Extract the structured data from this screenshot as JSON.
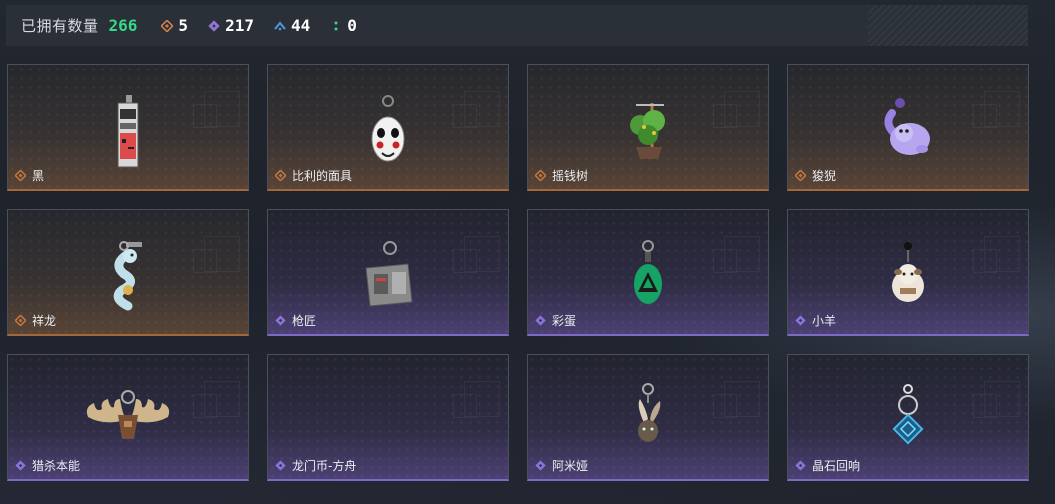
{
  "header": {
    "owned_label": "已拥有数量",
    "owned_count": "266",
    "stats": [
      {
        "icon": "orange-diamond-icon",
        "value": "5",
        "color": "#d0804a"
      },
      {
        "icon": "purple-diamond-icon",
        "value": "217",
        "color": "#8f77d6"
      },
      {
        "icon": "blue-chevron-icon",
        "value": "44",
        "color": "#4f9be0"
      },
      {
        "icon": "green-dots-icon",
        "value": "0",
        "color": "#3fd18f"
      }
    ]
  },
  "colors": {
    "orange": "#c9783d",
    "purple": "#8b72d9",
    "accent_green": "#36d98a"
  },
  "items": [
    {
      "name": "黑",
      "rarity": "orange"
    },
    {
      "name": "比利的面具",
      "rarity": "orange"
    },
    {
      "name": "摇钱树",
      "rarity": "orange"
    },
    {
      "name": "狻猊",
      "rarity": "orange"
    },
    {
      "name": "祥龙",
      "rarity": "orange"
    },
    {
      "name": "枪匠",
      "rarity": "purple"
    },
    {
      "name": "彩蛋",
      "rarity": "purple"
    },
    {
      "name": "小羊",
      "rarity": "purple"
    },
    {
      "name": "猎杀本能",
      "rarity": "purple"
    },
    {
      "name": "龙门币-方舟",
      "rarity": "purple"
    },
    {
      "name": "阿米娅",
      "rarity": "purple"
    },
    {
      "name": "晶石回响",
      "rarity": "purple"
    }
  ]
}
